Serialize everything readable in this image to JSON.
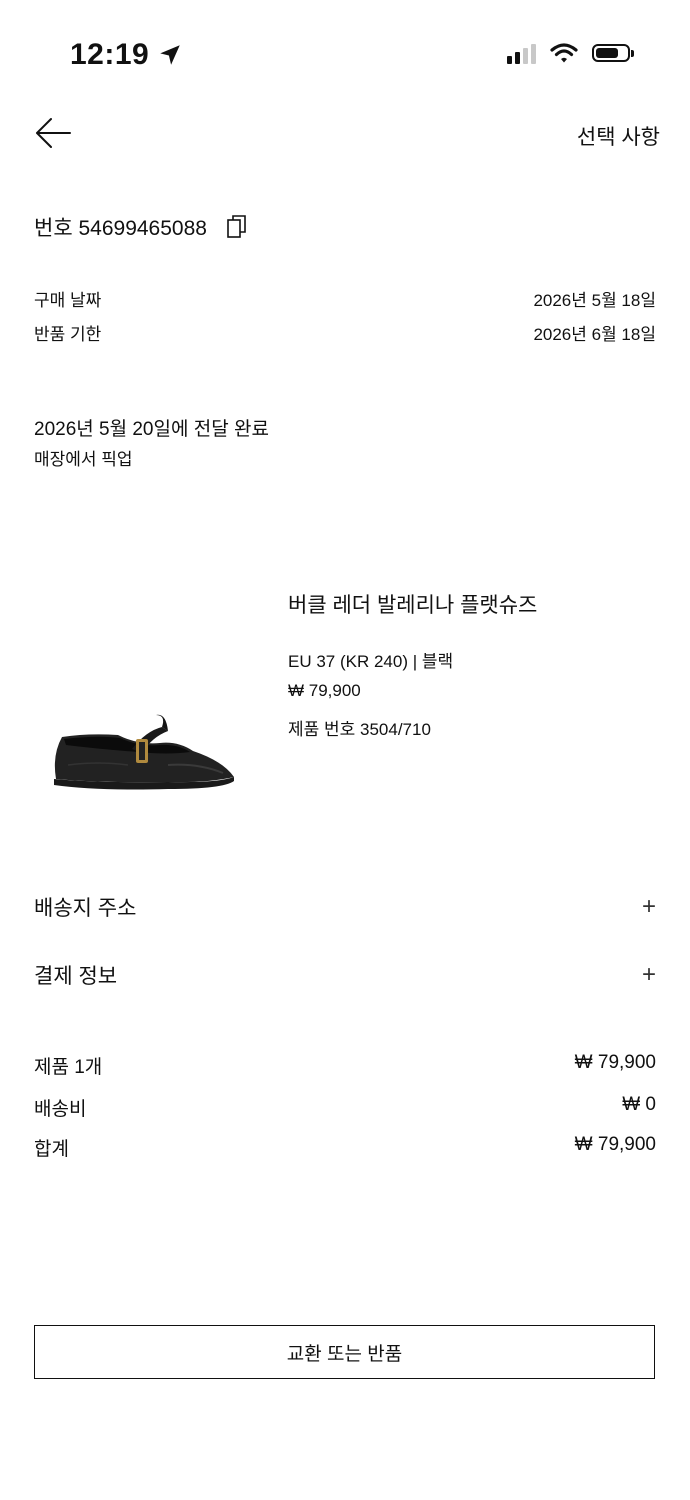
{
  "status_bar": {
    "time": "12:19"
  },
  "header": {
    "action_label": "선택 사항"
  },
  "order": {
    "number_label": "번호 54699465088"
  },
  "dates": {
    "purchase_label": "구매 날짜",
    "purchase_value": "2026년 5월 18일",
    "return_label": "반품 기한",
    "return_value": "2026년 6월 18일"
  },
  "delivery": {
    "status": "2026년 5월 20일에 전달 완료",
    "method": "매장에서 픽업"
  },
  "product": {
    "name": "버클 레더 발레리나 플랫슈즈",
    "variant": "EU 37 (KR 240) | 블랙",
    "price": "₩ 79,900",
    "code": "제품 번호 3504/710"
  },
  "sections": {
    "shipping_address": "배송지 주소",
    "payment_info": "결제 정보"
  },
  "summary": {
    "items_label": "제품 1개",
    "items_value": "₩ 79,900",
    "shipping_label": "배송비",
    "shipping_value": "₩ 0",
    "total_label": "합계",
    "total_value": "₩ 79,900"
  },
  "actions": {
    "return_button": "교환 또는 반품"
  }
}
